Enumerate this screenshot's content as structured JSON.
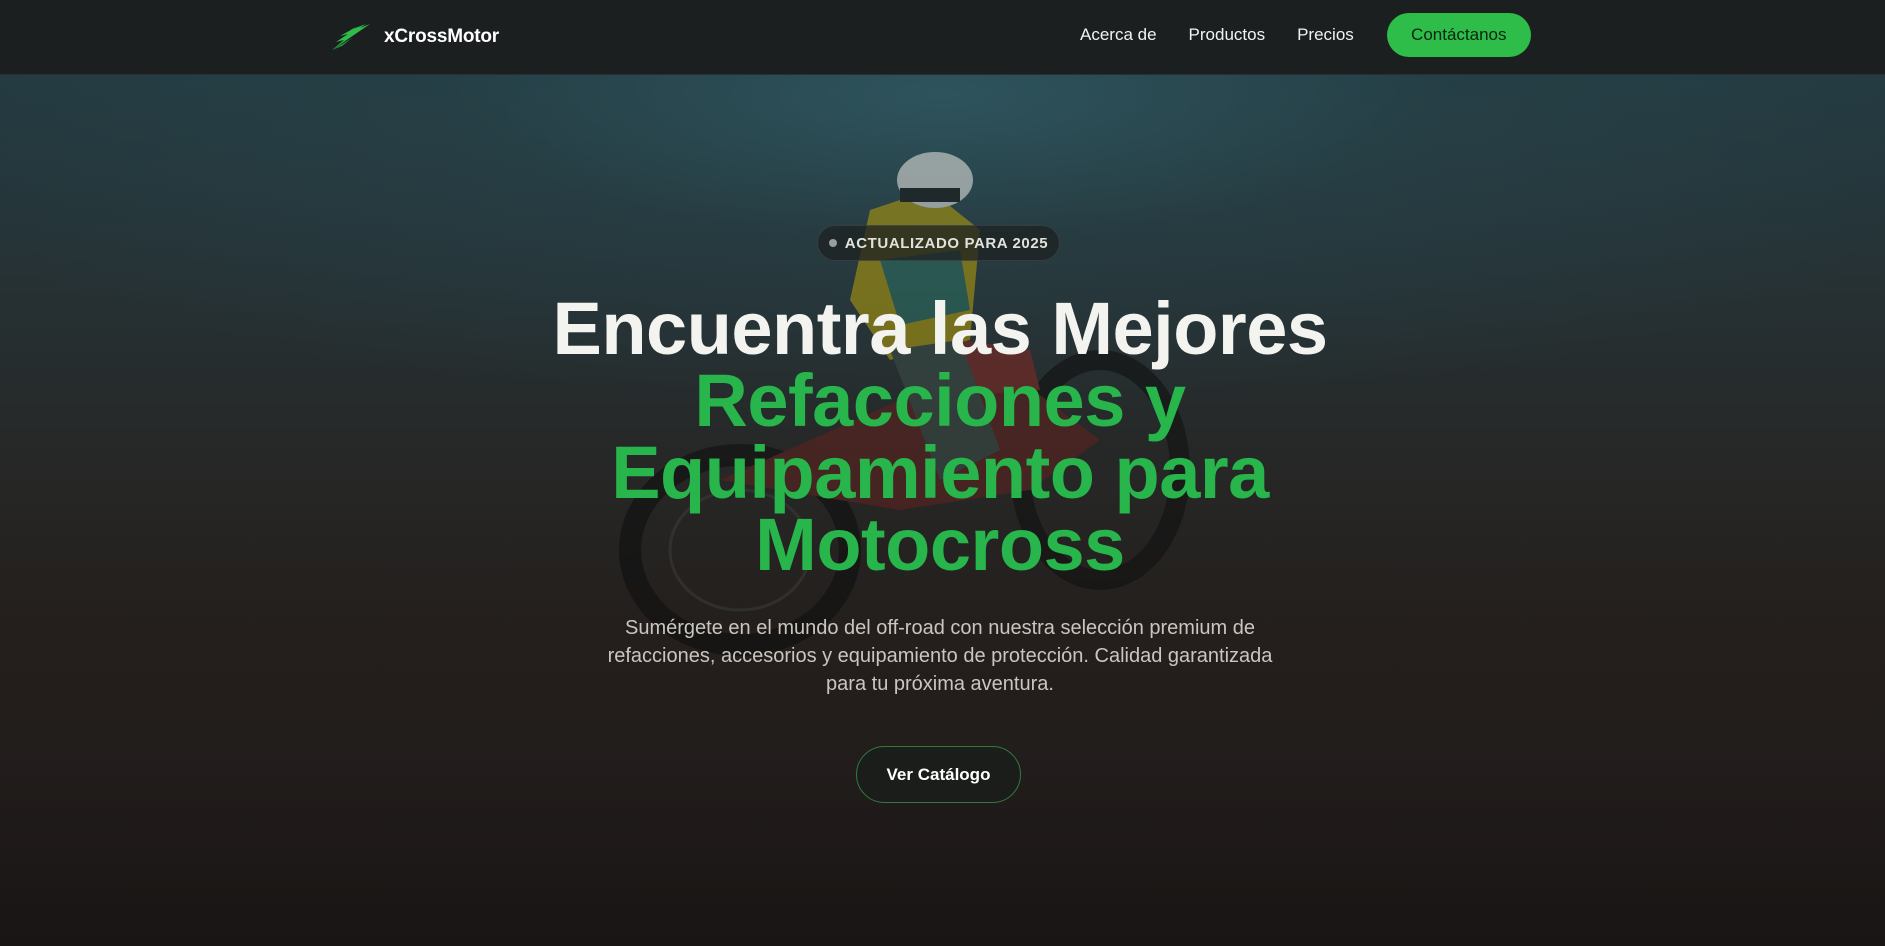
{
  "colors": {
    "accent": "#2dbd48",
    "headline_green": "#27b54c",
    "navbar_bg": "#1b1f20"
  },
  "navbar": {
    "brand_name": "xCrossMotor",
    "logo_icon": "wing-logo-icon",
    "links": [
      {
        "label": "Acerca de"
      },
      {
        "label": "Productos"
      },
      {
        "label": "Precios"
      }
    ],
    "cta_label": "Contáctanos"
  },
  "hero": {
    "badge_text": "ACTUALIZADO PARA 2025",
    "headline_line1": "Encuentra las Mejores",
    "headline_line2": "Refacciones y",
    "headline_line3": "Equipamiento para",
    "headline_line4": "Motocross",
    "subtitle": "Sumérgete en el mundo del off-road con nuestra selección premium de refacciones, accesorios y equipamiento de protección. Calidad garantizada para tu próxima aventura.",
    "catalog_button_label": "Ver Catálogo",
    "background_image": "motocross-rider-image"
  }
}
